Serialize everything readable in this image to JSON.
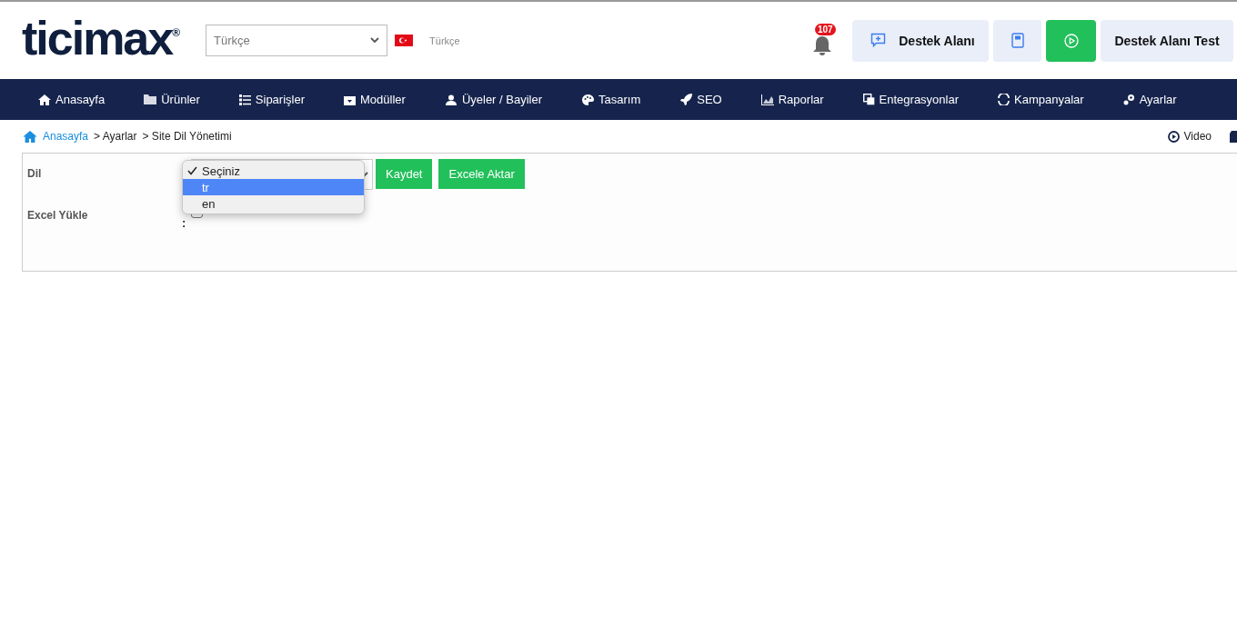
{
  "header": {
    "logo": "ticimax",
    "logo_mark": "®",
    "language_select": {
      "value": "Türkçe"
    },
    "language_label": "Türkçe",
    "notifications": {
      "count": "107"
    },
    "buttons": [
      {
        "kind": "support",
        "label": "Destek Alanı"
      },
      {
        "kind": "book"
      },
      {
        "kind": "play"
      },
      {
        "kind": "plain",
        "label": "Destek Alanı Test"
      }
    ]
  },
  "nav": [
    "Anasayfa",
    "Ürünler",
    "Siparişler",
    "Modüller",
    "Üyeler / Bayiler",
    "Tasarım",
    "SEO",
    "Raporlar",
    "Entegrasyonlar",
    "Kampanyalar",
    "Ayarlar"
  ],
  "breadcrumb": [
    "Anasayfa",
    "> Ayarlar",
    "> Site Dil Yönetimi"
  ],
  "video_link": "Video",
  "form": {
    "language_label": "Dil",
    "options": [
      {
        "label": "Seçiniz",
        "checked": true,
        "highlighted": false
      },
      {
        "label": "tr",
        "checked": false,
        "highlighted": true
      },
      {
        "label": "en",
        "checked": false,
        "highlighted": false
      }
    ],
    "buttons": [
      "Kaydet",
      "Excele Aktar"
    ],
    "excel_label": "Excel Yükle",
    "excel_colon": ":",
    "excel_checked": false
  }
}
